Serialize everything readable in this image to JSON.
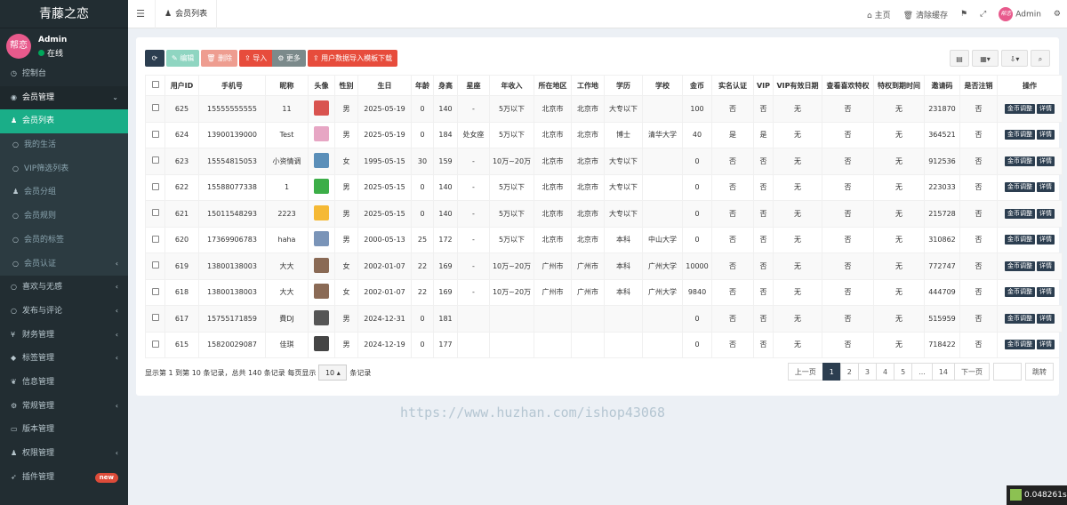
{
  "app": {
    "logo": "青藤之恋"
  },
  "user": {
    "avatar_text": "帮恋",
    "name": "Admin",
    "status": "在线"
  },
  "menu": [
    {
      "label": "控制台",
      "icon": "dashboard-icon",
      "type": "item"
    },
    {
      "label": "会员管理",
      "icon": "user-circle-icon",
      "type": "group-open",
      "arrow": "⌄"
    },
    {
      "label": "会员列表",
      "icon": "user-icon",
      "type": "active"
    },
    {
      "label": "我的生活",
      "icon": "circle-icon",
      "type": "sub"
    },
    {
      "label": "VIP筛选列表",
      "icon": "circle-icon",
      "type": "sub"
    },
    {
      "label": "会员分组",
      "icon": "users-icon",
      "type": "sub"
    },
    {
      "label": "会员规则",
      "icon": "circle-icon",
      "type": "sub"
    },
    {
      "label": "会员的标签",
      "icon": "circle-icon",
      "type": "sub"
    },
    {
      "label": "会员认证",
      "icon": "circle-icon",
      "type": "sub",
      "arrow": "‹"
    },
    {
      "label": "喜欢与无感",
      "icon": "circle-icon",
      "type": "item",
      "arrow": "‹"
    },
    {
      "label": "发布与评论",
      "icon": "circle-icon",
      "type": "item",
      "arrow": "‹"
    },
    {
      "label": "财务管理",
      "icon": "yen-icon",
      "type": "item",
      "arrow": "‹"
    },
    {
      "label": "标签管理",
      "icon": "tag-icon",
      "type": "item",
      "arrow": "‹"
    },
    {
      "label": "信息管理",
      "icon": "leaf-icon",
      "type": "item"
    },
    {
      "label": "常规管理",
      "icon": "cogs-icon",
      "type": "item",
      "arrow": "‹"
    },
    {
      "label": "版本管理",
      "icon": "file-icon",
      "type": "item"
    },
    {
      "label": "权限管理",
      "icon": "group-icon",
      "type": "item",
      "arrow": "‹"
    },
    {
      "label": "插件管理",
      "icon": "rocket-icon",
      "type": "item",
      "badge": "new"
    }
  ],
  "topbar": {
    "tab_label": "会员列表",
    "home": "主页",
    "clear_cache": "清除缓存",
    "admin_name": "Admin",
    "avatar_text": "帮恋"
  },
  "toolbar": {
    "edit": "编辑",
    "delete": "删除",
    "import": "导入",
    "more": "更多",
    "template": "用户数据导入模板下载"
  },
  "table": {
    "headers": [
      "用户ID",
      "手机号",
      "昵称",
      "头像",
      "性别",
      "生日",
      "年龄",
      "身高",
      "星座",
      "年收入",
      "所在地区",
      "工作地",
      "学历",
      "学校",
      "金币",
      "实名认证",
      "VIP",
      "VIP有效日期",
      "查看喜欢特权",
      "特权到期时间",
      "邀请码",
      "是否注销",
      "操作"
    ],
    "rows": [
      {
        "id": "625",
        "phone": "15555555555",
        "nick": "11",
        "avatar_color": "#d9534f",
        "gender": "男",
        "birthday": "2025-05-19",
        "age": "0",
        "height": "140",
        "star": "-",
        "income": "5万以下",
        "region": "北京市",
        "work": "北京市",
        "edu": "大专以下",
        "school": "",
        "coins": "100",
        "realname": "否",
        "vip": "否",
        "vip_date": "无",
        "like_priv": "否",
        "priv_end": "无",
        "invite": "231870",
        "cancel": "否"
      },
      {
        "id": "624",
        "phone": "13900139000",
        "nick": "Test",
        "avatar_color": "#e7a6c4",
        "gender": "男",
        "birthday": "2025-05-19",
        "age": "0",
        "height": "184",
        "star": "处女座",
        "income": "5万以下",
        "region": "北京市",
        "work": "北京市",
        "edu": "博士",
        "school": "清华大学",
        "coins": "40",
        "realname": "是",
        "vip": "是",
        "vip_date": "无",
        "like_priv": "否",
        "priv_end": "无",
        "invite": "364521",
        "cancel": "否"
      },
      {
        "id": "623",
        "phone": "15554815053",
        "nick": "小资情调",
        "avatar_color": "#5b8fb9",
        "gender": "女",
        "birthday": "1995-05-15",
        "age": "30",
        "height": "159",
        "star": "-",
        "income": "10万~20万",
        "region": "北京市",
        "work": "北京市",
        "edu": "大专以下",
        "school": "",
        "coins": "0",
        "realname": "否",
        "vip": "否",
        "vip_date": "无",
        "like_priv": "否",
        "priv_end": "无",
        "invite": "912536",
        "cancel": "否"
      },
      {
        "id": "622",
        "phone": "15588077338",
        "nick": "1",
        "avatar_color": "#3cae48",
        "gender": "男",
        "birthday": "2025-05-15",
        "age": "0",
        "height": "140",
        "star": "-",
        "income": "5万以下",
        "region": "北京市",
        "work": "北京市",
        "edu": "大专以下",
        "school": "",
        "coins": "0",
        "realname": "否",
        "vip": "否",
        "vip_date": "无",
        "like_priv": "否",
        "priv_end": "无",
        "invite": "223033",
        "cancel": "否"
      },
      {
        "id": "621",
        "phone": "15011548293",
        "nick": "2223",
        "avatar_color": "#f5b935",
        "gender": "男",
        "birthday": "2025-05-15",
        "age": "0",
        "height": "140",
        "star": "-",
        "income": "5万以下",
        "region": "北京市",
        "work": "北京市",
        "edu": "大专以下",
        "school": "",
        "coins": "0",
        "realname": "否",
        "vip": "否",
        "vip_date": "无",
        "like_priv": "否",
        "priv_end": "无",
        "invite": "215728",
        "cancel": "否"
      },
      {
        "id": "620",
        "phone": "17369906783",
        "nick": "haha",
        "avatar_color": "#7a94b8",
        "gender": "男",
        "birthday": "2000-05-13",
        "age": "25",
        "height": "172",
        "star": "-",
        "income": "5万以下",
        "region": "北京市",
        "work": "北京市",
        "edu": "本科",
        "school": "中山大学",
        "coins": "0",
        "realname": "否",
        "vip": "否",
        "vip_date": "无",
        "like_priv": "否",
        "priv_end": "无",
        "invite": "310862",
        "cancel": "否"
      },
      {
        "id": "619",
        "phone": "13800138003",
        "nick": "大大",
        "avatar_color": "#8a6a55",
        "gender": "女",
        "birthday": "2002-01-07",
        "age": "22",
        "height": "169",
        "star": "-",
        "income": "10万~20万",
        "region": "广州市",
        "work": "广州市",
        "edu": "本科",
        "school": "广州大学",
        "coins": "10000",
        "realname": "否",
        "vip": "否",
        "vip_date": "无",
        "like_priv": "否",
        "priv_end": "无",
        "invite": "772747",
        "cancel": "否"
      },
      {
        "id": "618",
        "phone": "13800138003",
        "nick": "大大",
        "avatar_color": "#8a6a55",
        "gender": "女",
        "birthday": "2002-01-07",
        "age": "22",
        "height": "169",
        "star": "-",
        "income": "10万~20万",
        "region": "广州市",
        "work": "广州市",
        "edu": "本科",
        "school": "广州大学",
        "coins": "9840",
        "realname": "否",
        "vip": "否",
        "vip_date": "无",
        "like_priv": "否",
        "priv_end": "无",
        "invite": "444709",
        "cancel": "否"
      },
      {
        "id": "617",
        "phone": "15755171859",
        "nick": "費DJ",
        "avatar_color": "#555555",
        "gender": "男",
        "birthday": "2024-12-31",
        "age": "0",
        "height": "181",
        "star": "",
        "income": "",
        "region": "",
        "work": "",
        "edu": "",
        "school": "",
        "coins": "0",
        "realname": "否",
        "vip": "否",
        "vip_date": "无",
        "like_priv": "否",
        "priv_end": "无",
        "invite": "515959",
        "cancel": "否"
      },
      {
        "id": "615",
        "phone": "15820029087",
        "nick": "佳琪",
        "avatar_color": "#444444",
        "gender": "男",
        "birthday": "2024-12-19",
        "age": "0",
        "height": "177",
        "star": "",
        "income": "",
        "region": "",
        "work": "",
        "edu": "",
        "school": "",
        "coins": "0",
        "realname": "否",
        "vip": "否",
        "vip_date": "无",
        "like_priv": "否",
        "priv_end": "无",
        "invite": "718422",
        "cancel": "否"
      }
    ],
    "op_coin": "金币调整",
    "op_detail": "详情"
  },
  "footer": {
    "summary": "显示第 1 到第 10 条记录，总共 140 条记录 每页显示",
    "page_size": "10 ▴",
    "suffix": "条记录"
  },
  "pager": {
    "prev": "上一页",
    "pages": [
      "1",
      "2",
      "3",
      "4",
      "5",
      "...",
      "14"
    ],
    "next": "下一页",
    "jump": "跳转"
  },
  "watermark": "https://www.huzhan.com/ishop43068",
  "timer": "0.048261s"
}
